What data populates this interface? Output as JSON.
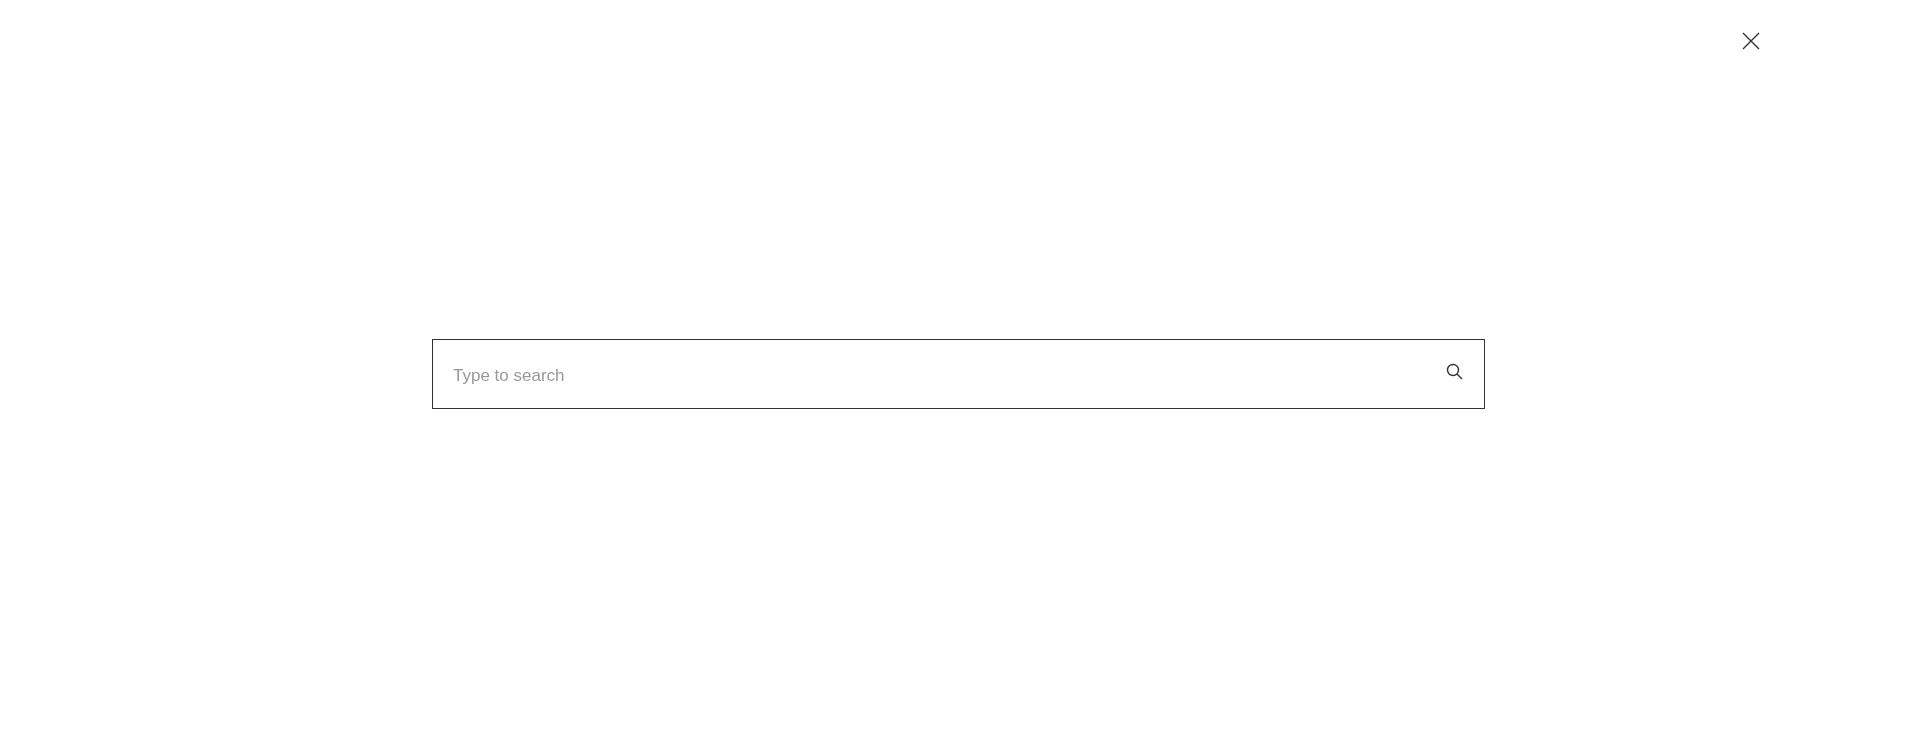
{
  "search": {
    "placeholder": "Type to search"
  }
}
